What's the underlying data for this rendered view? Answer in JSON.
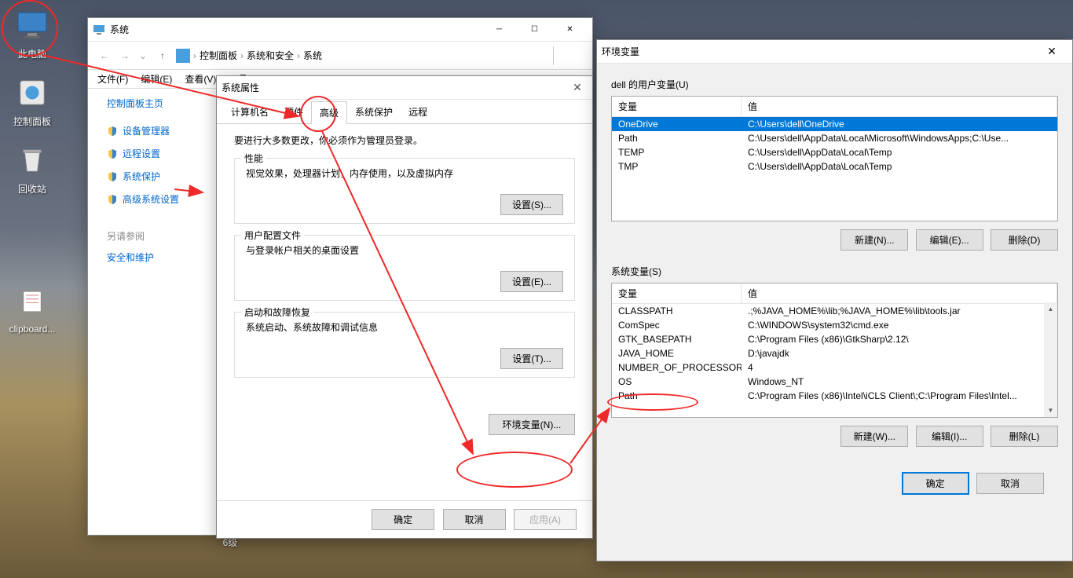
{
  "desktop": {
    "icons": [
      {
        "label": "此电脑"
      },
      {
        "label": "控制面板"
      },
      {
        "label": "回收站"
      },
      {
        "label": "clipboard..."
      },
      {
        "label": "6级"
      }
    ]
  },
  "sysWindow": {
    "title": "系统",
    "breadcrumb": [
      "控制面板",
      "系统和安全",
      "系统"
    ],
    "menus": [
      "文件(F)",
      "编辑(E)",
      "查看(V)",
      "工具(T)"
    ],
    "homeLink": "控制面板主页",
    "sideItems": [
      "设备管理器",
      "远程设置",
      "系统保护",
      "高级系统设置"
    ],
    "relatedLabel": "另请参阅",
    "relatedLink": "安全和维护"
  },
  "propsWindow": {
    "title": "系统属性",
    "tabs": [
      "计算机名",
      "硬件",
      "高级",
      "系统保护",
      "远程"
    ],
    "activeTab": 2,
    "adminNote": "要进行大多数更改，你必须作为管理员登录。",
    "perf": {
      "legend": "性能",
      "desc": "视觉效果，处理器计划，内存使用，以及虚拟内存",
      "btn": "设置(S)..."
    },
    "profile": {
      "legend": "用户配置文件",
      "desc": "与登录帐户相关的桌面设置",
      "btn": "设置(E)..."
    },
    "startup": {
      "legend": "启动和故障恢复",
      "desc": "系统启动、系统故障和调试信息",
      "btn": "设置(T)..."
    },
    "envBtn": "环境变量(N)...",
    "footer": {
      "ok": "确定",
      "cancel": "取消",
      "apply": "应用(A)"
    }
  },
  "envWindow": {
    "title": "环境变量",
    "userSection": "dell 的用户变量(U)",
    "sysSection": "系统变量(S)",
    "headers": {
      "var": "变量",
      "val": "值"
    },
    "userVars": [
      {
        "name": "OneDrive",
        "value": "C:\\Users\\dell\\OneDrive",
        "selected": true
      },
      {
        "name": "Path",
        "value": "C:\\Users\\dell\\AppData\\Local\\Microsoft\\WindowsApps;C:\\Use..."
      },
      {
        "name": "TEMP",
        "value": "C:\\Users\\dell\\AppData\\Local\\Temp"
      },
      {
        "name": "TMP",
        "value": "C:\\Users\\dell\\AppData\\Local\\Temp"
      }
    ],
    "sysVars": [
      {
        "name": "CLASSPATH",
        "value": ".;%JAVA_HOME%\\lib;%JAVA_HOME%\\lib\\tools.jar"
      },
      {
        "name": "ComSpec",
        "value": "C:\\WINDOWS\\system32\\cmd.exe"
      },
      {
        "name": "GTK_BASEPATH",
        "value": "C:\\Program Files (x86)\\GtkSharp\\2.12\\"
      },
      {
        "name": "JAVA_HOME",
        "value": "D:\\javajdk"
      },
      {
        "name": "NUMBER_OF_PROCESSORS",
        "value": "4"
      },
      {
        "name": "OS",
        "value": "Windows_NT"
      },
      {
        "name": "Path",
        "value": "C:\\Program Files (x86)\\Intel\\iCLS Client\\;C:\\Program Files\\Intel..."
      }
    ],
    "userBtns": {
      "new": "新建(N)...",
      "edit": "编辑(E)...",
      "del": "删除(D)"
    },
    "sysBtns": {
      "new": "新建(W)...",
      "edit": "编辑(I)...",
      "del": "删除(L)"
    },
    "footer": {
      "ok": "确定",
      "cancel": "取消"
    }
  }
}
